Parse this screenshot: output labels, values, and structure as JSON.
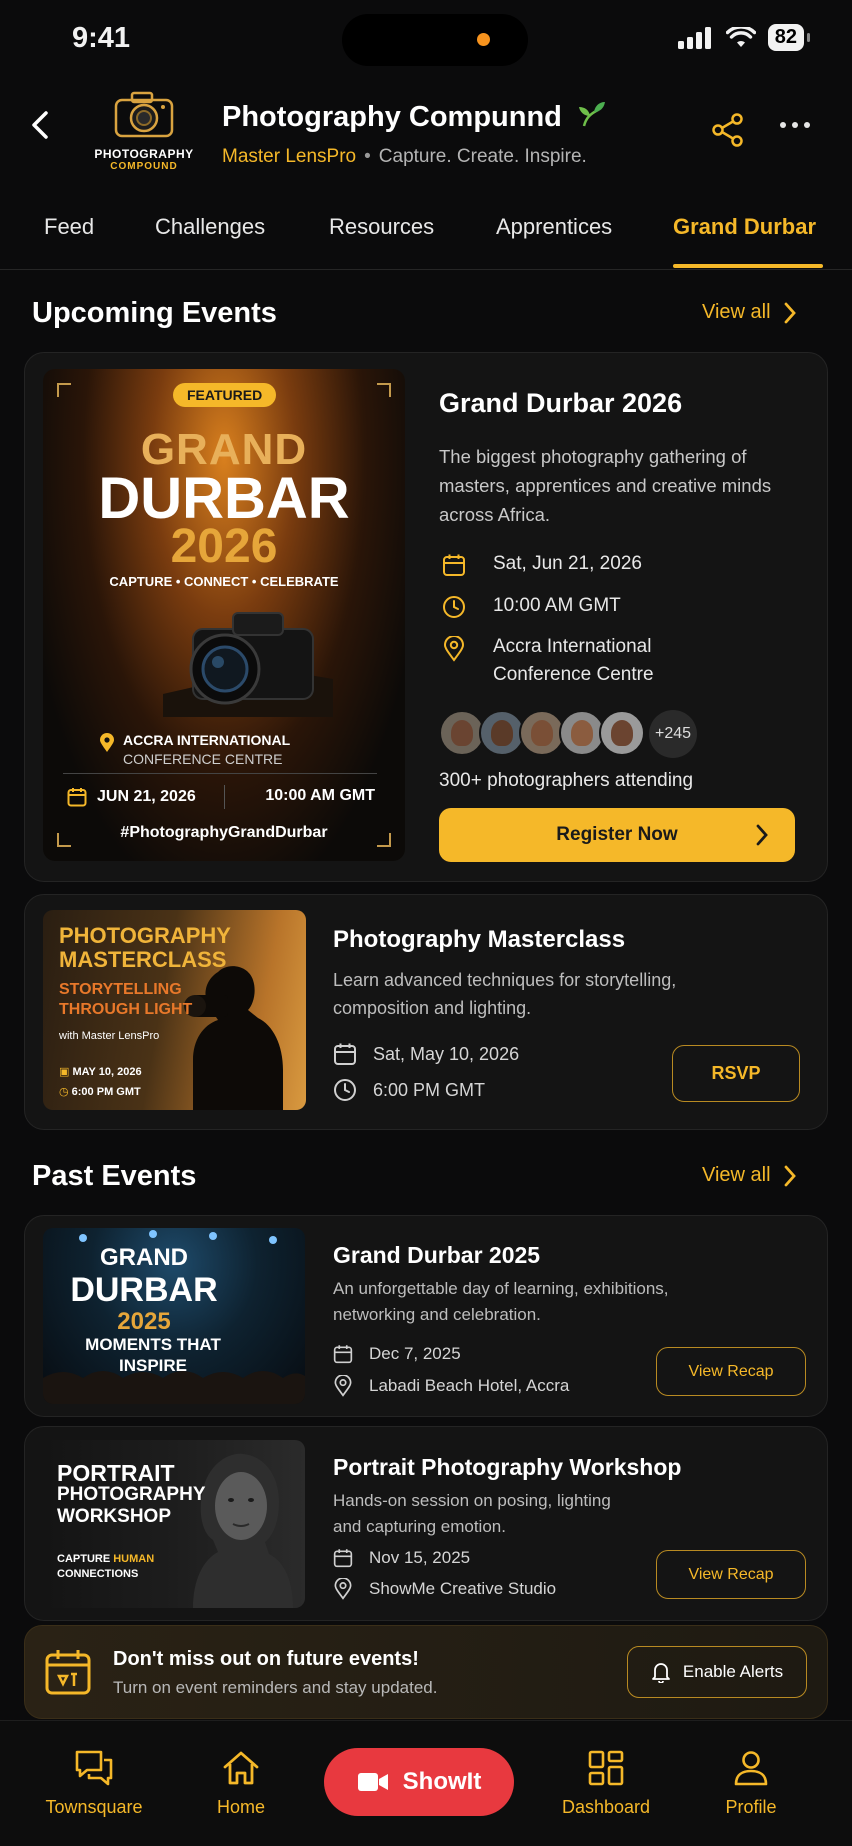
{
  "status": {
    "time": "9:41",
    "battery": "82"
  },
  "header": {
    "logo_line1": "PHOTOGRAPHY",
    "logo_line2": "COMPOUND",
    "title": "Photography Compunnd",
    "badge": "Master LensPro",
    "tagline": "Capture. Create. Inspire.",
    "icons": [
      "back-icon",
      "share-icon",
      "more-icon",
      "sprout-icon"
    ]
  },
  "tabs": [
    {
      "label": "Feed"
    },
    {
      "label": "Challenges"
    },
    {
      "label": "Resources"
    },
    {
      "label": "Apprentices"
    },
    {
      "label": "Grand Durbar",
      "active": true
    }
  ],
  "upcoming": {
    "title": "Upcoming Events",
    "view_all": "View all",
    "featured": {
      "poster": {
        "badge": "FEATURED",
        "line1": "GRAND",
        "line2": "DURBAR",
        "line3": "2026",
        "tagline": "CAPTURE • CONNECT • CELEBRATE",
        "venue_line1": "ACCRA INTERNATIONAL",
        "venue_line2": "CONFERENCE CENTRE",
        "date": "JUN 21, 2026",
        "time": "10:00 AM GMT",
        "hashtag": "#PhotographyGrandDurbar"
      },
      "title": "Grand Durbar 2026",
      "description": "The biggest photography gathering of masters, apprentices and creative minds across Africa.",
      "date": "Sat, Jun 21, 2026",
      "time": "10:00 AM GMT",
      "venue_line1": "Accra International",
      "venue_line2": "Conference Centre",
      "more_count": "+245",
      "attending": "300+ photographers attending",
      "register": "Register Now"
    },
    "masterclass": {
      "thumb_line1": "PHOTOGRAPHY",
      "thumb_line2": "MASTERCLASS",
      "thumb_line3": "STORYTELLING",
      "thumb_line4": "THROUGH LIGHT",
      "thumb_host": "with Master LensPro",
      "thumb_date": "MAY 10, 2026",
      "thumb_time": "6:00 PM GMT",
      "title": "Photography Masterclass",
      "description": "Learn advanced techniques for storytelling, composition and lighting.",
      "date": "Sat, May 10, 2026",
      "time": "6:00 PM GMT",
      "rsvp": "RSVP"
    }
  },
  "past": {
    "title": "Past Events",
    "view_all": "View all",
    "items": [
      {
        "thumb_line1": "GRAND",
        "thumb_line2": "DURBAR",
        "thumb_line3": "2025",
        "thumb_line4": "MOMENTS THAT",
        "thumb_line5": "INSPIRE",
        "title": "Grand Durbar 2025",
        "description": "An unforgettable day of learning, exhibitions, networking and celebration.",
        "date": "Dec 7, 2025",
        "venue": "Labadi Beach Hotel, Accra",
        "button": "View Recap"
      },
      {
        "thumb_line1": "PORTRAIT",
        "thumb_line2": "PHOTOGRAPHY",
        "thumb_line3": "WORKSHOP",
        "thumb_line4a": "CAPTURE",
        "thumb_line4b": "HUMAN",
        "thumb_line5": "CONNECTIONS",
        "title": "Portrait Photography Workshop",
        "description": "Hands-on session on posing, lighting and capturing emotion.",
        "date": "Nov 15, 2025",
        "venue": "ShowMe Creative Studio",
        "button": "View Recap"
      }
    ]
  },
  "notify": {
    "title": "Don't miss out on future events!",
    "subtitle": "Turn on event reminders and stay updated.",
    "button": "Enable Alerts"
  },
  "nav": {
    "townsquare": "Townsquare",
    "home": "Home",
    "showit": "ShowIt",
    "dashboard": "Dashboard",
    "profile": "Profile"
  },
  "colors": {
    "accent": "#f5b829",
    "background": "#0b0b0c",
    "card": "#141414",
    "showit": "#e8393f"
  }
}
